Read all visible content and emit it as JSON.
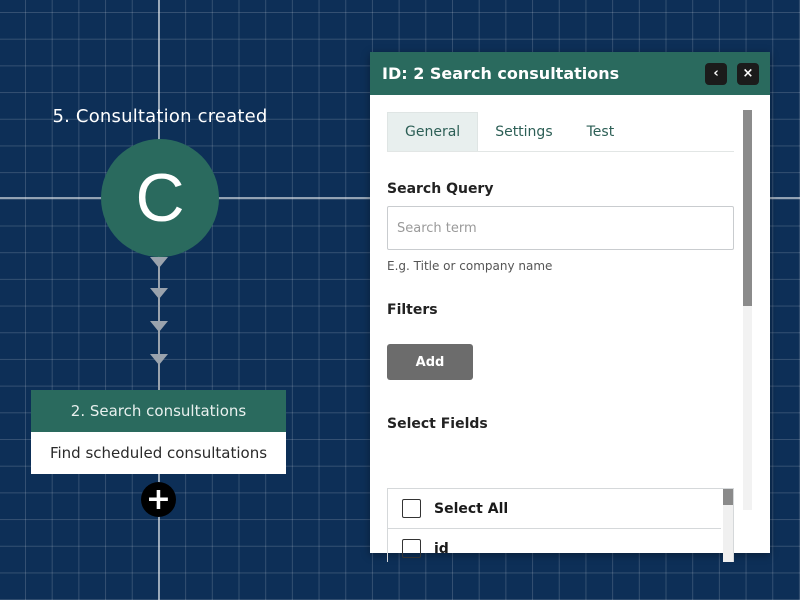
{
  "canvas": {
    "trigger": {
      "title": "5. Consultation created",
      "letter": "C"
    },
    "step": {
      "header": "2. Search consultations",
      "description": "Find scheduled consultations"
    },
    "add_node_label": "+"
  },
  "panel": {
    "title": "ID: 2  Search consultations",
    "back_button_label": "‹",
    "close_button_label": "×",
    "tabs": [
      {
        "label": "General",
        "active": true
      },
      {
        "label": "Settings",
        "active": false
      },
      {
        "label": "Test",
        "active": false
      }
    ],
    "search_query": {
      "label": "Search Query",
      "placeholder": "Search term",
      "value": "",
      "hint": "E.g. Title or company name"
    },
    "filters": {
      "label": "Filters",
      "add_button": "Add"
    },
    "select_fields": {
      "label": "Select Fields",
      "items": [
        {
          "label": "Select All"
        },
        {
          "label": "id"
        }
      ]
    }
  },
  "colors": {
    "canvas_bg": "#0d2f57",
    "accent": "#2a6a5e",
    "button_gray": "#6c6c6c"
  }
}
